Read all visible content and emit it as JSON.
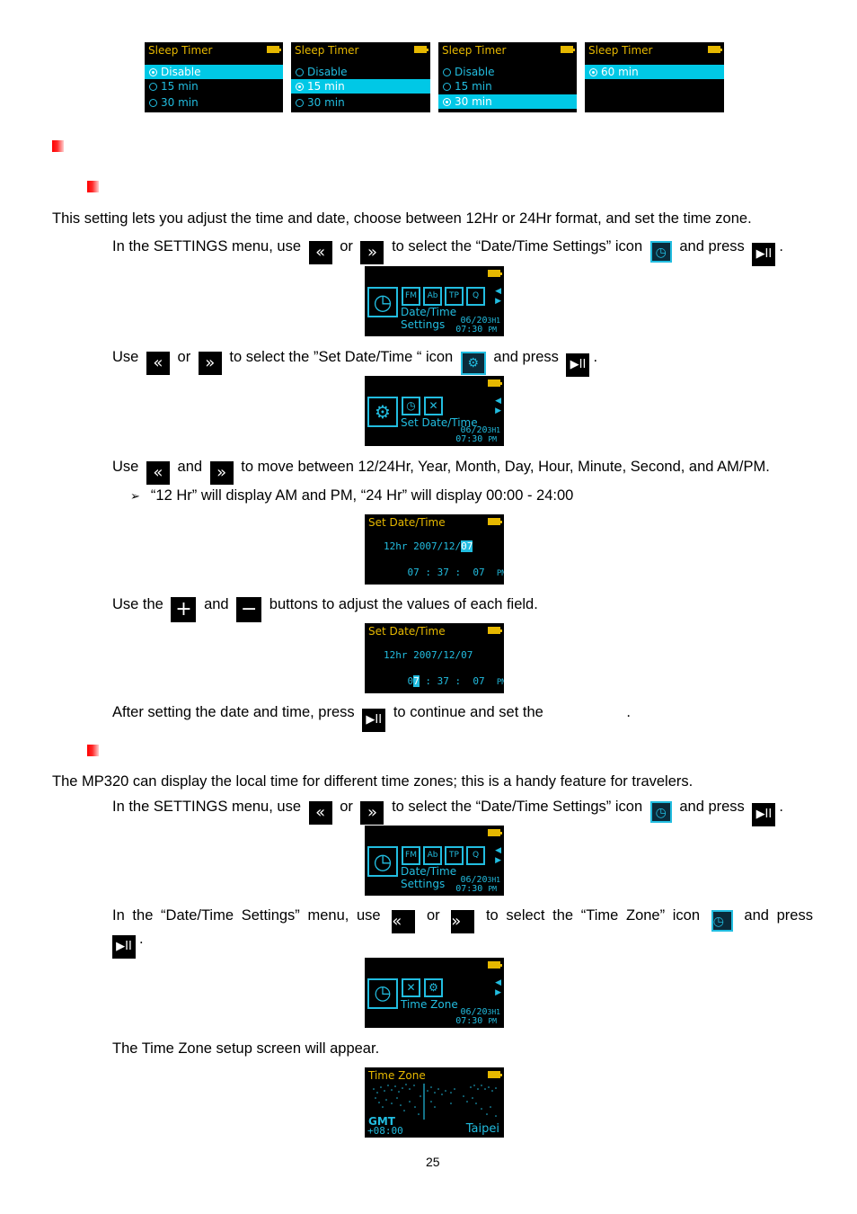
{
  "sleep_timer_screens": [
    {
      "title": "Sleep Timer",
      "items": [
        {
          "label": "Disable",
          "selected": true
        },
        {
          "label": "15 min",
          "selected": false
        },
        {
          "label": "30 min",
          "selected": false
        }
      ]
    },
    {
      "title": "Sleep Timer",
      "items": [
        {
          "label": "Disable",
          "selected": false
        },
        {
          "label": "15 min",
          "selected": true
        },
        {
          "label": "30 min",
          "selected": false
        }
      ]
    },
    {
      "title": "Sleep Timer",
      "items": [
        {
          "label": "Disable",
          "selected": false
        },
        {
          "label": "15 min",
          "selected": false
        },
        {
          "label": "30 min",
          "selected": true
        }
      ]
    },
    {
      "title": "Sleep Timer",
      "items": [
        {
          "label": "60 min",
          "selected": true
        }
      ]
    }
  ],
  "intro": "This setting lets you adjust the time and date, choose between 12Hr or 24Hr format, and set the time zone.",
  "keys": {
    "prev": "«",
    "next": "»",
    "play_pause": "▶II",
    "plus": "+",
    "minus": "−"
  },
  "step1": {
    "a": "In the SETTINGS menu, use",
    "b": "or",
    "c": "to select the “Date/Time Settings” icon",
    "d": "and press",
    "e": "."
  },
  "settings_screen": {
    "label": "Date/Time Settings",
    "date": "06/20",
    "sub": "3H1",
    "time": "07:30",
    "ampm": "PM",
    "icons": [
      "clock-icon",
      "fm-icon",
      "abc-icon",
      "mtp-icon",
      "eq-icon"
    ]
  },
  "step2": {
    "a": "Use",
    "b": "or",
    "c": "to select the ”Set Date/Time “ icon",
    "d": "and press",
    "e": "."
  },
  "setdt_menu_screen": {
    "label": "Set Date/Time",
    "date": "06/20",
    "sub": "3H1",
    "time": "07:30",
    "ampm": "PM"
  },
  "step3": {
    "a": "Use",
    "b": "and",
    "c": "to move between 12/24Hr, Year, Month, Day, Hour, Minute, Second, and AM/PM."
  },
  "note": {
    "bullet": "➢",
    "text": "“12 Hr” will display AM and PM, “24 Hr” will display 00:00 - 24:00"
  },
  "setdt_screen_1": {
    "title": "Set Date/Time",
    "format": "12hr",
    "date_prefix": "2007/12/",
    "day": "07",
    "hour": "07",
    "minute": "37",
    "second": "07",
    "ampm": "PM"
  },
  "step4": {
    "a": "Use the",
    "b": "and",
    "c": "buttons to adjust the values of each field."
  },
  "setdt_screen_2": {
    "title": "Set Date/Time",
    "format": "12hr",
    "date": "2007/12/07",
    "hour_a": "0",
    "hour_b": "7",
    "minute": "37",
    "second": "07",
    "ampm": "PM"
  },
  "step5": {
    "a": "After setting the date and time, press",
    "b": "to continue and set the",
    "c": "."
  },
  "tz_intro": "The MP320 can display the local time for different time zones; this is a handy feature for travelers.",
  "step6": {
    "a": "In the SETTINGS menu, use",
    "b": "or",
    "c": "to select the “Date/Time Settings” icon",
    "d": "and press",
    "e": "."
  },
  "step7": {
    "a": "In the “Date/Time Settings” menu, use",
    "b": "or",
    "c": "to select the “Time Zone” icon",
    "d": "and press",
    "e": "."
  },
  "tz_menu_screen": {
    "label": "Time Zone",
    "date": "06/20",
    "sub": "3H1",
    "time": "07:30",
    "ampm": "PM"
  },
  "step8": "The Time Zone setup screen will appear.",
  "tz_screen": {
    "title": "Time Zone",
    "zone": "GMT",
    "offset": "+08:00",
    "city": "Taipei"
  },
  "page_number": "25"
}
